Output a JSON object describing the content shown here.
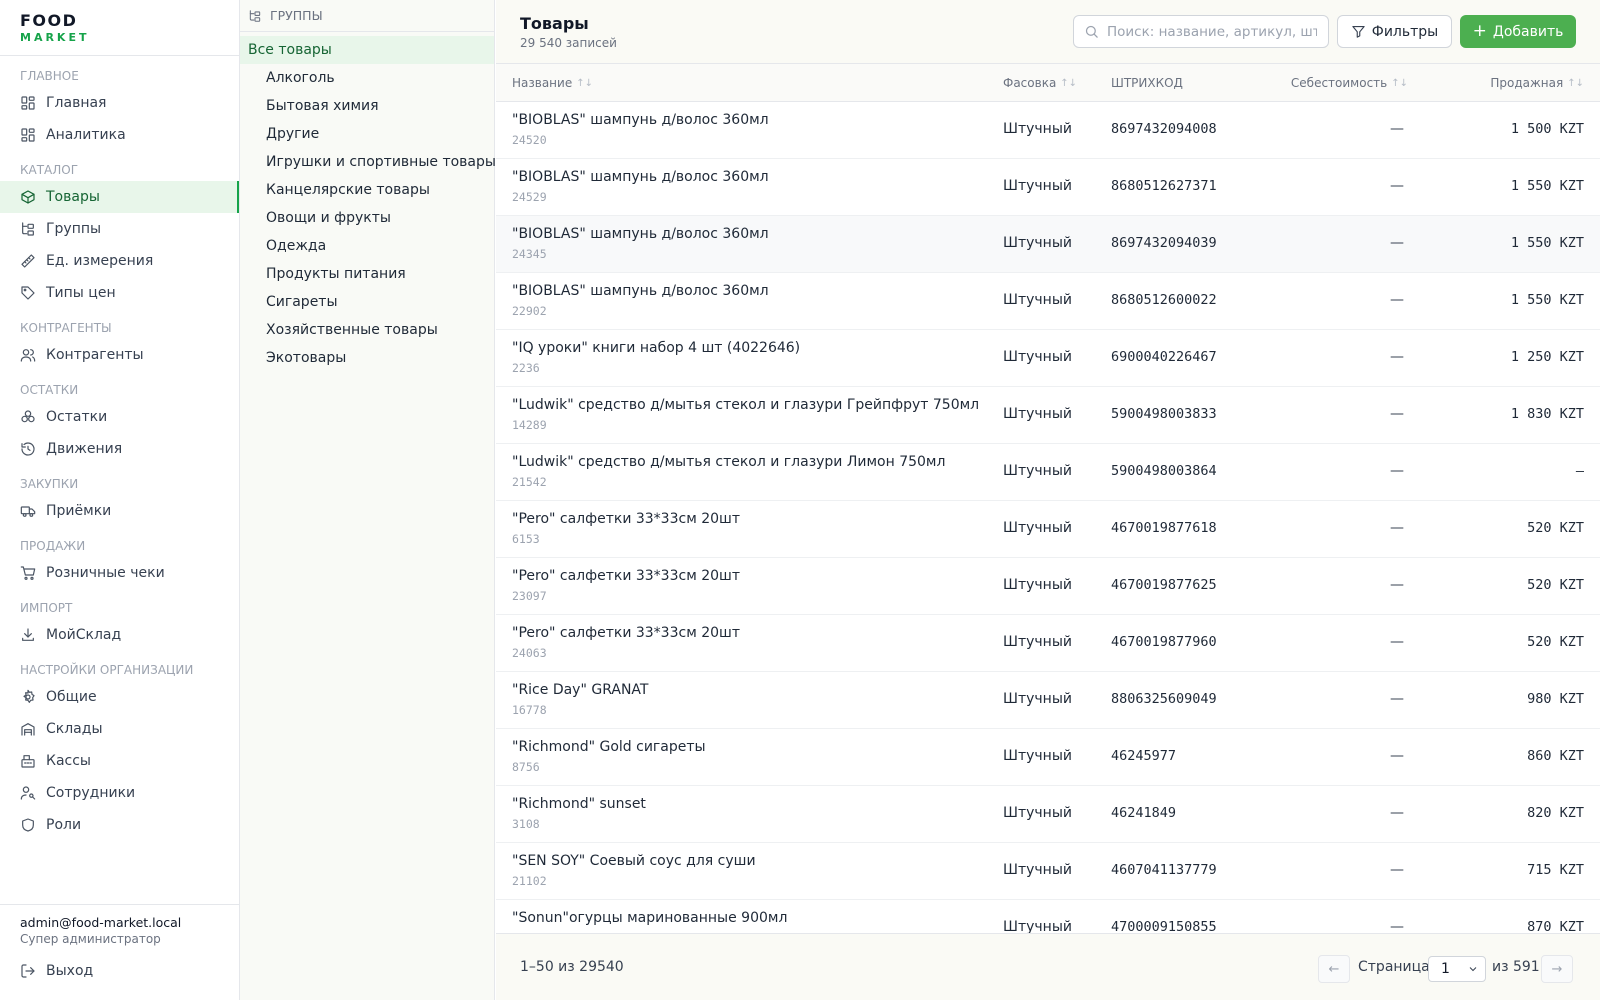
{
  "brand": {
    "line1": "FOOD",
    "line2": "MARKET"
  },
  "sidebar": {
    "sections": [
      {
        "title": "ГЛАВНОЕ",
        "items": [
          {
            "label": "Главная",
            "icon": "dashboard-icon",
            "active": false
          },
          {
            "label": "Аналитика",
            "icon": "dashboard-icon",
            "active": false
          }
        ]
      },
      {
        "title": "КАТАЛОГ",
        "items": [
          {
            "label": "Товары",
            "icon": "box-icon",
            "active": true
          },
          {
            "label": "Группы",
            "icon": "tree-icon",
            "active": false
          },
          {
            "label": "Ед. измерения",
            "icon": "ruler-icon",
            "active": false
          },
          {
            "label": "Типы цен",
            "icon": "tag-icon",
            "active": false
          }
        ]
      },
      {
        "title": "КОНТРАГЕНТЫ",
        "items": [
          {
            "label": "Контрагенты",
            "icon": "users-icon",
            "active": false
          }
        ]
      },
      {
        "title": "ОСТАТКИ",
        "items": [
          {
            "label": "Остатки",
            "icon": "boxes-icon",
            "active": false
          },
          {
            "label": "Движения",
            "icon": "history-icon",
            "active": false
          }
        ]
      },
      {
        "title": "ЗАКУПКИ",
        "items": [
          {
            "label": "Приёмки",
            "icon": "truck-icon",
            "active": false
          }
        ]
      },
      {
        "title": "ПРОДАЖИ",
        "items": [
          {
            "label": "Розничные чеки",
            "icon": "cart-icon",
            "active": false
          }
        ]
      },
      {
        "title": "ИМПОРТ",
        "items": [
          {
            "label": "МойСклад",
            "icon": "download-icon",
            "active": false
          }
        ]
      },
      {
        "title": "НАСТРОЙКИ ОРГАНИЗАЦИИ",
        "items": [
          {
            "label": "Общие",
            "icon": "gear-icon",
            "active": false
          },
          {
            "label": "Склады",
            "icon": "warehouse-icon",
            "active": false
          },
          {
            "label": "Кассы",
            "icon": "register-icon",
            "active": false
          },
          {
            "label": "Сотрудники",
            "icon": "user-key-icon",
            "active": false
          },
          {
            "label": "Роли",
            "icon": "shield-icon",
            "active": false
          }
        ]
      }
    ],
    "user": {
      "email": "admin@food-market.local",
      "role": "Супер администратор",
      "logout": "Выход"
    }
  },
  "groups": {
    "header": "ГРУППЫ",
    "all_label": "Все товары",
    "items": [
      "Алкоголь",
      "Бытовая химия",
      "Другие",
      "Игрушки и спортивные товары",
      "Канцелярские товары",
      "Овощи и фрукты",
      "Одежда",
      "Продукты питания",
      "Сигареты",
      "Хозяйственные товары",
      "Экотовары"
    ]
  },
  "header": {
    "title": "Товары",
    "subtitle": "29 540 записей",
    "search_placeholder": "Поиск: название, артикул, штрихкод",
    "filter_label": "Фильтры",
    "add_label": "Добавить"
  },
  "table": {
    "columns": {
      "name": "Название",
      "pack": "Фасовка",
      "barcode": "ШТРИХКОД",
      "cost": "Себестоимость",
      "price": "Продажная"
    },
    "rows": [
      {
        "name": "\"BIOBLAS\" шампунь д/волос 360мл",
        "sku": "24520",
        "pack": "Штучный",
        "barcode": "8697432094008",
        "cost": "—",
        "price": "1 500 KZT"
      },
      {
        "name": "\"BIOBLAS\" шампунь д/волос 360мл",
        "sku": "24529",
        "pack": "Штучный",
        "barcode": "8680512627371",
        "cost": "—",
        "price": "1 550 KZT"
      },
      {
        "name": "\"BIOBLAS\" шампунь д/волос 360мл",
        "sku": "24345",
        "pack": "Штучный",
        "barcode": "8697432094039",
        "cost": "—",
        "price": "1 550 KZT"
      },
      {
        "name": "\"BIOBLAS\" шампунь д/волос 360мл",
        "sku": "22902",
        "pack": "Штучный",
        "barcode": "8680512600022",
        "cost": "—",
        "price": "1 550 KZT"
      },
      {
        "name": "\"IQ уроки\" книги набор 4 шт (4022646)",
        "sku": "2236",
        "pack": "Штучный",
        "barcode": "6900040226467",
        "cost": "—",
        "price": "1 250 KZT"
      },
      {
        "name": "\"Ludwik\" средство д/мытья стекол и глазури Грейпфрут 750мл",
        "sku": "14289",
        "pack": "Штучный",
        "barcode": "5900498003833",
        "cost": "—",
        "price": "1 830 KZT"
      },
      {
        "name": "\"Ludwik\" средство д/мытья стекол и глазури Лимон 750мл",
        "sku": "21542",
        "pack": "Штучный",
        "barcode": "5900498003864",
        "cost": "—",
        "price": "—"
      },
      {
        "name": "\"Pero\" салфетки 33*33см 20шт",
        "sku": "6153",
        "pack": "Штучный",
        "barcode": "4670019877618",
        "cost": "—",
        "price": "520 KZT"
      },
      {
        "name": "\"Pero\" салфетки 33*33см 20шт",
        "sku": "23097",
        "pack": "Штучный",
        "barcode": "4670019877625",
        "cost": "—",
        "price": "520 KZT"
      },
      {
        "name": "\"Pero\" салфетки 33*33см 20шт",
        "sku": "24063",
        "pack": "Штучный",
        "barcode": "4670019877960",
        "cost": "—",
        "price": "520 KZT"
      },
      {
        "name": "\"Rice Day\" GRANAT",
        "sku": "16778",
        "pack": "Штучный",
        "barcode": "8806325609049",
        "cost": "—",
        "price": "980 KZT"
      },
      {
        "name": "\"Richmond\" Gold сигареты",
        "sku": "8756",
        "pack": "Штучный",
        "barcode": "46245977",
        "cost": "—",
        "price": "860 KZT"
      },
      {
        "name": "\"Richmond\" sunset",
        "sku": "3108",
        "pack": "Штучный",
        "barcode": "46241849",
        "cost": "—",
        "price": "820 KZT"
      },
      {
        "name": "\"SEN SOY\" Соевый соус для суши",
        "sku": "21102",
        "pack": "Штучный",
        "barcode": "4607041137779",
        "cost": "—",
        "price": "715 KZT"
      },
      {
        "name": "\"Sonun\"огурцы маринованные 900мл",
        "sku": "",
        "pack": "Штучный",
        "barcode": "4700009150855",
        "cost": "—",
        "price": "870 KZT"
      }
    ]
  },
  "pager": {
    "count_text": "1–50 из 29540",
    "prev": "←",
    "next": "→",
    "page_label": "Страница",
    "page_value": "1",
    "of_label": "из 591"
  },
  "colors": {
    "accent": "#16a34a",
    "add_button": "#4caf50",
    "active_bg": "#e8f6ea"
  }
}
